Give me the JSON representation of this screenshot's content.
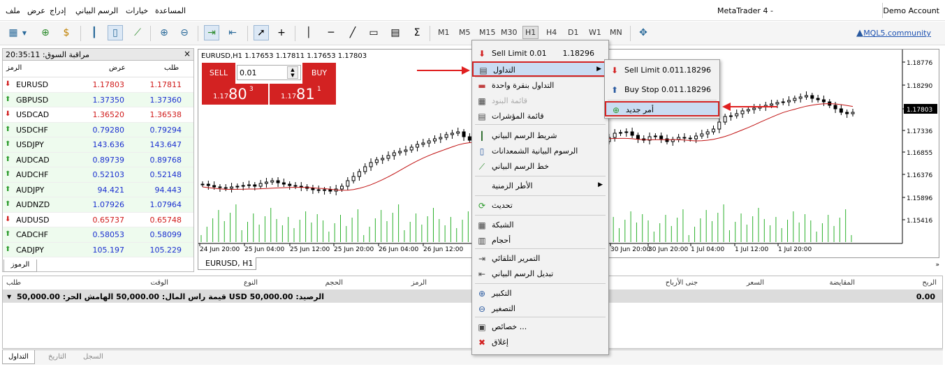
{
  "menubar": {
    "items": [
      "ملف",
      "عرض",
      "إدراج",
      "الرسم البياني",
      "خيارات",
      "المساعدة"
    ],
    "title": "MetaTrader 4 -",
    "account": "Demo Account"
  },
  "toolbar": {
    "timeframes": [
      "M1",
      "M5",
      "M15",
      "M30",
      "H1",
      "H4",
      "D1",
      "W1",
      "MN"
    ],
    "active_tf": "H1",
    "mql": "MQL5.community"
  },
  "market_watch": {
    "title": "مراقبة السوق: 20:35:11",
    "col_symbol": "الرمز",
    "col_bid": "عرض",
    "col_ask": "طلب",
    "tab": "الرموز",
    "rows": [
      {
        "sym": "EURUSD",
        "bid": "1.17803",
        "ask": "1.17811",
        "dir": "down"
      },
      {
        "sym": "GBPUSD",
        "bid": "1.37350",
        "ask": "1.37360",
        "dir": "up"
      },
      {
        "sym": "USDCAD",
        "bid": "1.36520",
        "ask": "1.36538",
        "dir": "down"
      },
      {
        "sym": "USDCHF",
        "bid": "0.79280",
        "ask": "0.79294",
        "dir": "up"
      },
      {
        "sym": "USDJPY",
        "bid": "143.636",
        "ask": "143.647",
        "dir": "up"
      },
      {
        "sym": "AUDCAD",
        "bid": "0.89739",
        "ask": "0.89768",
        "dir": "up"
      },
      {
        "sym": "AUDCHF",
        "bid": "0.52103",
        "ask": "0.52148",
        "dir": "up"
      },
      {
        "sym": "AUDJPY",
        "bid": "94.421",
        "ask": "94.443",
        "dir": "up"
      },
      {
        "sym": "AUDNZD",
        "bid": "1.07926",
        "ask": "1.07964",
        "dir": "up"
      },
      {
        "sym": "AUDUSD",
        "bid": "0.65737",
        "ask": "0.65748",
        "dir": "down"
      },
      {
        "sym": "CADCHF",
        "bid": "0.58053",
        "ask": "0.58099",
        "dir": "up"
      },
      {
        "sym": "CADJPY",
        "bid": "105.197",
        "ask": "105.229",
        "dir": "up"
      }
    ]
  },
  "chart": {
    "header": "EURUSD,H1  1.17653 1.17811 1.17653 1.17803",
    "tab": "EURUSD, H1",
    "sell_label": "SELL",
    "buy_label": "BUY",
    "lot": "0.01",
    "sell_small": "1.17",
    "sell_big": "80",
    "sell_sup": "3",
    "buy_small": "1.17",
    "buy_big": "81",
    "buy_sup": "1",
    "current_price": "1.17803",
    "y_ticks": [
      "1.18776",
      "1.18290",
      "1.17803",
      "1.17336",
      "1.16855",
      "1.16376",
      "1.15896",
      "1.15416"
    ],
    "x_ticks": [
      "24 Jun 20:00",
      "25 Jun 04:00",
      "25 Jun 12:00",
      "25 Jun 20:00",
      "26 Jun 04:00",
      "26 Jun 12:00",
      "30 Jun 20:00",
      "30 Jun 20:00",
      "1 Jul 04:00",
      "1 Jul 12:00",
      "1 Jul 20:00"
    ]
  },
  "terminal": {
    "headers": [
      "الربح",
      "المقايضة",
      "السعر",
      "جنى الأرباح",
      "الرمز",
      "الحجم",
      "النوع",
      "الوقت",
      "طلب"
    ],
    "summary": "قيمة راس المال: 50,000.00  الهامش الحر: 50,000.00  USD  الرصيد: 50,000.00",
    "profit": "0.00",
    "tabs": [
      "التداول",
      "التاريخ",
      "السجل"
    ]
  },
  "context_menu": {
    "items": [
      {
        "label": "Sell Limit 0.01",
        "right": "1.18296",
        "icon": "sell-limit-icon"
      },
      {
        "label": "التداول",
        "icon": "trade-icon",
        "submenu": true
      },
      {
        "label": "التداول بنقرة واحدة",
        "icon": "one-click-trading-icon"
      },
      {
        "label": "قائمة البنود",
        "icon": "depth-of-market-icon",
        "disabled": true
      },
      {
        "label": "قائمة المؤشرات",
        "icon": "indicators-list-icon"
      },
      {
        "label": "شريط الرسم البياني",
        "icon": "bar-chart-icon"
      },
      {
        "label": "الرسوم البيانية الشمعدانات",
        "icon": "candlesticks-icon"
      },
      {
        "label": "خط الرسم البياني",
        "icon": "line-chart-icon"
      },
      {
        "label": "الأطر الزمنية",
        "icon": "timeframes-icon",
        "submenu": true
      },
      {
        "label": "تحديث",
        "icon": "refresh-icon"
      },
      {
        "label": "الشبكة",
        "icon": "grid-icon"
      },
      {
        "label": "أحجام",
        "icon": "volumes-icon"
      },
      {
        "label": "التمرير التلقائي",
        "icon": "auto-scroll-icon"
      },
      {
        "label": "تبديل الرسم البياني",
        "icon": "chart-shift-icon"
      },
      {
        "label": "التكبير",
        "icon": "zoom-in-icon"
      },
      {
        "label": "التصغير",
        "icon": "zoom-out-icon"
      },
      {
        "label": "خصائص ...",
        "icon": "properties-icon"
      },
      {
        "label": "إغلاق",
        "icon": "close-icon"
      }
    ]
  },
  "submenu": {
    "items": [
      {
        "label": "Sell Limit 0.01",
        "right": "1.18296"
      },
      {
        "label": "Buy Stop 0.01",
        "right": "1.18296"
      },
      {
        "label": "أمر جديد"
      }
    ]
  }
}
